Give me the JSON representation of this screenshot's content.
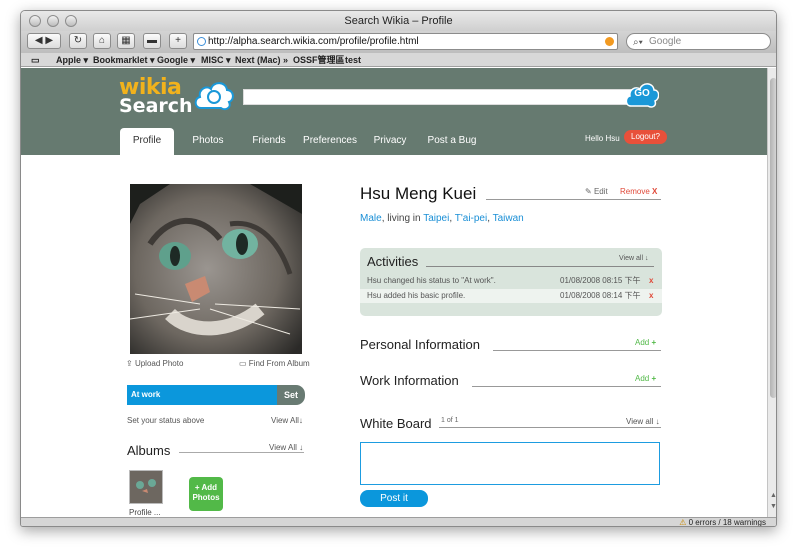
{
  "browser": {
    "window_title": "Search Wikia – Profile",
    "url": "http://alpha.search.wikia.com/profile/profile.html",
    "search_placeholder": "Google",
    "bookmarks": [
      "Apple ▾",
      "Bookmarklet ▾",
      "Google ▾",
      "MISC ▾",
      "Next (Mac) »",
      "OSSF管理區",
      "test"
    ],
    "status": "0 errors / 18 warnings"
  },
  "header": {
    "logo_top": "wikia",
    "logo_bottom": "Search",
    "go_label": "GO",
    "tabs": [
      {
        "label": "Profile",
        "active": true
      },
      {
        "label": "Photos"
      },
      {
        "label": "Friends"
      },
      {
        "label": "Preferences"
      },
      {
        "label": "Privacy"
      },
      {
        "label": "Post a Bug"
      }
    ],
    "hello": "Hello Hsu",
    "logout": "Logout?"
  },
  "sidebar": {
    "upload_photo": "Upload Photo",
    "find_from_album": "Find From Album",
    "status_value": "At work",
    "set_label": "Set",
    "status_hint": "Set your status above",
    "view_all": "View All",
    "albums_title": "Albums",
    "albums_view_all": "View All",
    "album_label": "Profile ...",
    "add_photos": "+ Add Photos"
  },
  "profile": {
    "name": "Hsu Meng Kuei",
    "edit": "Edit",
    "remove": "Remove",
    "gender": "Male",
    "living_in": ", living in ",
    "city": "Taipei",
    "region": "T'ai-pei",
    "country": "Taiwan"
  },
  "activities": {
    "title": "Activities",
    "view_all": "View all",
    "items": [
      {
        "text": "Hsu changed his status to \"At work\".",
        "date": "01/08/2008 08:15 下午"
      },
      {
        "text": "Hsu added his basic profile.",
        "date": "01/08/2008 08:14 下午"
      }
    ]
  },
  "sections": {
    "personal": "Personal Information",
    "work": "Work Information",
    "add": "Add"
  },
  "whiteboard": {
    "title": "White Board",
    "count": "1 of 1",
    "view_all": "View all",
    "post": "Post it"
  },
  "colors": {
    "header_bg": "#667a70",
    "accent_blue": "#0b97dc",
    "logout_red": "#e8503a",
    "add_green": "#52b948"
  }
}
